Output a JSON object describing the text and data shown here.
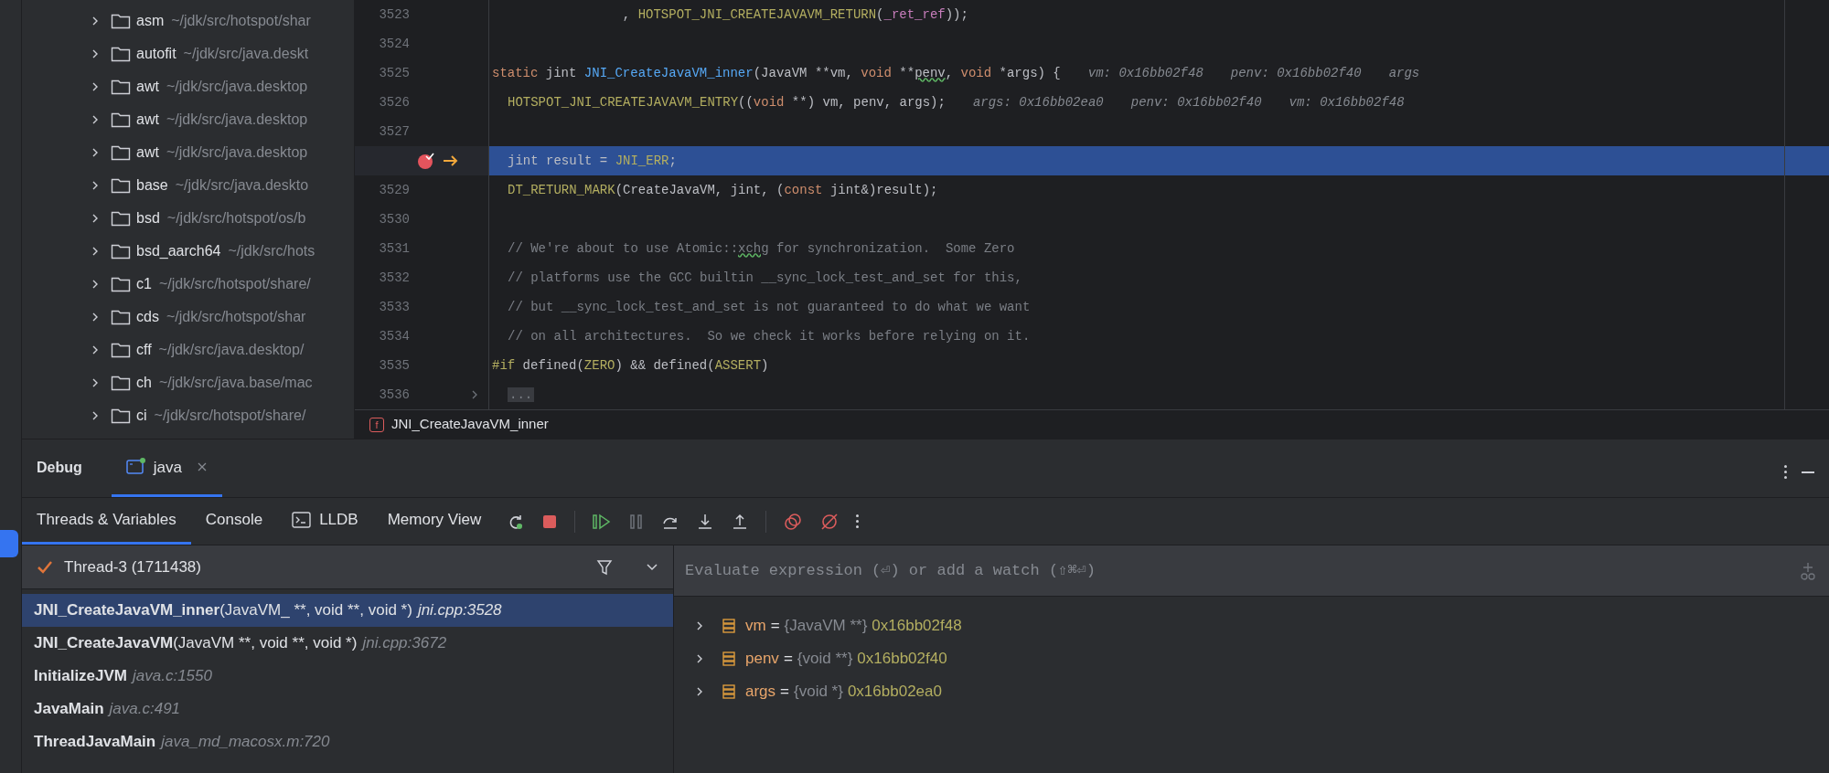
{
  "project_tree": {
    "items": [
      {
        "name": "asm",
        "path": "~/jdk/src/hotspot/shar",
        "expanded": false
      },
      {
        "name": "autofit",
        "path": "~/jdk/src/java.deskt",
        "expanded": false
      },
      {
        "name": "awt",
        "path": "~/jdk/src/java.desktop",
        "expanded": false
      },
      {
        "name": "awt",
        "path": "~/jdk/src/java.desktop",
        "expanded": false
      },
      {
        "name": "awt",
        "path": "~/jdk/src/java.desktop",
        "expanded": false
      },
      {
        "name": "base",
        "path": "~/jdk/src/java.deskto",
        "expanded": false
      },
      {
        "name": "bsd",
        "path": "~/jdk/src/hotspot/os/b",
        "expanded": false
      },
      {
        "name": "bsd_aarch64",
        "path": "~/jdk/src/hots",
        "expanded": false
      },
      {
        "name": "c1",
        "path": "~/jdk/src/hotspot/share/",
        "expanded": false
      },
      {
        "name": "cds",
        "path": "~/jdk/src/hotspot/shar",
        "expanded": false
      },
      {
        "name": "cff",
        "path": "~/jdk/src/java.desktop/",
        "expanded": false
      },
      {
        "name": "ch",
        "path": "~/jdk/src/java.base/mac",
        "expanded": false
      },
      {
        "name": "ci",
        "path": "~/jdk/src/hotspot/share/",
        "expanded": false
      }
    ]
  },
  "editor": {
    "lines": [
      {
        "number": "3523",
        "breakpoint": false,
        "current": false,
        "folded": false,
        "tokens": [
          {
            "kind": "plain",
            "text": "                 , "
          },
          {
            "kind": "macro",
            "text": "HOTSPOT_JNI_CREATEJAVAVM_RETURN"
          },
          {
            "kind": "plain",
            "text": "("
          },
          {
            "kind": "field",
            "text": "_ret_ref"
          },
          {
            "kind": "plain",
            "text": "));"
          }
        ]
      },
      {
        "number": "3524",
        "breakpoint": false,
        "current": false,
        "folded": false
      },
      {
        "number": "3525",
        "breakpoint": false,
        "current": false,
        "folded": false,
        "tokens": [
          {
            "kind": "keyword",
            "text": "static "
          },
          {
            "kind": "plain",
            "text": "jint "
          },
          {
            "kind": "function",
            "text": "JNI_CreateJavaVM_inner"
          },
          {
            "kind": "plain",
            "text": "(JavaVM **vm, "
          },
          {
            "kind": "keyword",
            "text": "void "
          },
          {
            "kind": "plain",
            "text": "**"
          },
          {
            "kind": "typo",
            "text": "penv"
          },
          {
            "kind": "plain",
            "text": ", "
          },
          {
            "kind": "keyword",
            "text": "void "
          },
          {
            "kind": "plain",
            "text": "*args) {"
          }
        ],
        "hints": [
          "vm: 0x16bb02f48",
          "penv: 0x16bb02f40",
          "args"
        ]
      },
      {
        "number": "3526",
        "breakpoint": false,
        "current": false,
        "folded": false,
        "indented": true,
        "tokens": [
          {
            "kind": "macro",
            "text": "HOTSPOT_JNI_CREATEJAVAVM_ENTRY"
          },
          {
            "kind": "plain",
            "text": "(("
          },
          {
            "kind": "keyword",
            "text": "void"
          },
          {
            "kind": "plain",
            "text": " **) vm, penv, args);"
          }
        ],
        "hints": [
          "args: 0x16bb02ea0",
          "penv: 0x16bb02f40",
          "vm: 0x16bb02f48"
        ]
      },
      {
        "number": "3527",
        "breakpoint": false,
        "current": false,
        "folded": false
      },
      {
        "breakpoint": true,
        "current": true,
        "folded": false,
        "indented": true,
        "tokens": [
          {
            "kind": "plain",
            "text": "jint result = "
          },
          {
            "kind": "macro",
            "text": "JNI_ERR"
          },
          {
            "kind": "plain",
            "text": ";"
          }
        ]
      },
      {
        "number": "3529",
        "breakpoint": false,
        "current": false,
        "folded": false,
        "indented": true,
        "tokens": [
          {
            "kind": "macro",
            "text": "DT_RETURN_MARK"
          },
          {
            "kind": "plain",
            "text": "(CreateJavaVM, jint, ("
          },
          {
            "kind": "keyword",
            "text": "const"
          },
          {
            "kind": "plain",
            "text": " jint&)result);"
          }
        ]
      },
      {
        "number": "3530",
        "breakpoint": false,
        "current": false,
        "folded": false
      },
      {
        "number": "3531",
        "breakpoint": false,
        "current": false,
        "folded": false,
        "indented": true,
        "tokens": [
          {
            "kind": "comment",
            "text": "// We're about to use Atomic::"
          },
          {
            "kind": "comment_typo",
            "text": "xchg"
          },
          {
            "kind": "comment",
            "text": " for synchronization.  Some Zero"
          }
        ]
      },
      {
        "number": "3532",
        "breakpoint": false,
        "current": false,
        "folded": false,
        "indented": true,
        "tokens": [
          {
            "kind": "comment",
            "text": "// platforms use the GCC builtin __sync_lock_test_and_set for this,"
          }
        ]
      },
      {
        "number": "3533",
        "breakpoint": false,
        "current": false,
        "folded": false,
        "indented": true,
        "tokens": [
          {
            "kind": "comment",
            "text": "// but __sync_lock_test_and_set is not guaranteed to do what we want"
          }
        ]
      },
      {
        "number": "3534",
        "breakpoint": false,
        "current": false,
        "folded": false,
        "indented": true,
        "tokens": [
          {
            "kind": "comment",
            "text": "// on all architectures.  So we check it works before relying on it."
          }
        ]
      },
      {
        "number": "3535",
        "breakpoint": false,
        "current": false,
        "folded": false,
        "tokens": [
          {
            "kind": "preproc",
            "text": "#if "
          },
          {
            "kind": "plain",
            "text": "defined("
          },
          {
            "kind": "macro",
            "text": "ZERO"
          },
          {
            "kind": "plain",
            "text": ") && defined("
          },
          {
            "kind": "macro",
            "text": "ASSERT"
          },
          {
            "kind": "plain",
            "text": ")"
          }
        ]
      },
      {
        "number": "3536",
        "breakpoint": false,
        "current": false,
        "folded": true,
        "indented": true,
        "tokens": [
          {
            "kind": "fold",
            "text": "..."
          }
        ]
      }
    ],
    "breadcrumb": {
      "icon_letter": "f",
      "label": "JNI_CreateJavaVM_inner"
    }
  },
  "debug": {
    "title": "Debug",
    "sessions": [
      {
        "label": "java",
        "selected": true
      }
    ],
    "tabs": [
      {
        "label": "Threads & Variables",
        "selected": true,
        "kind": "plain"
      },
      {
        "label": "Console",
        "selected": false,
        "kind": "plain"
      },
      {
        "label": "LLDB",
        "selected": false,
        "kind": "terminal"
      },
      {
        "label": "Memory View",
        "selected": false,
        "kind": "plain"
      }
    ],
    "thread": "Thread-3 (1711438)",
    "frames": [
      {
        "function": "JNI_CreateJavaVM_inner",
        "params": "(JavaVM_ **, void **, void *)",
        "location": "jni.cpp:3528",
        "selected": true
      },
      {
        "function": "JNI_CreateJavaVM",
        "params": "(JavaVM **, void **, void *)",
        "location": "jni.cpp:3672",
        "selected": false
      },
      {
        "function": "InitializeJVM",
        "location": "java.c:1550",
        "selected": false
      },
      {
        "function": "JavaMain",
        "location": "java.c:491",
        "selected": false
      },
      {
        "function": "ThreadJavaMain",
        "location": "java_md_macosx.m:720",
        "selected": false
      }
    ],
    "evaluate": {
      "placeholder": "Evaluate expression (⏎) or add a watch (⇧⌘⏎)"
    },
    "variables": [
      {
        "name": "vm",
        "assign": "=",
        "type": "{JavaVM **}",
        "value": "0x16bb02f48"
      },
      {
        "name": "penv",
        "assign": "=",
        "type": "{void **}",
        "value": "0x16bb02f40"
      },
      {
        "name": "args",
        "assign": "=",
        "type": "{void *}",
        "value": "0x16bb02ea0"
      }
    ]
  }
}
